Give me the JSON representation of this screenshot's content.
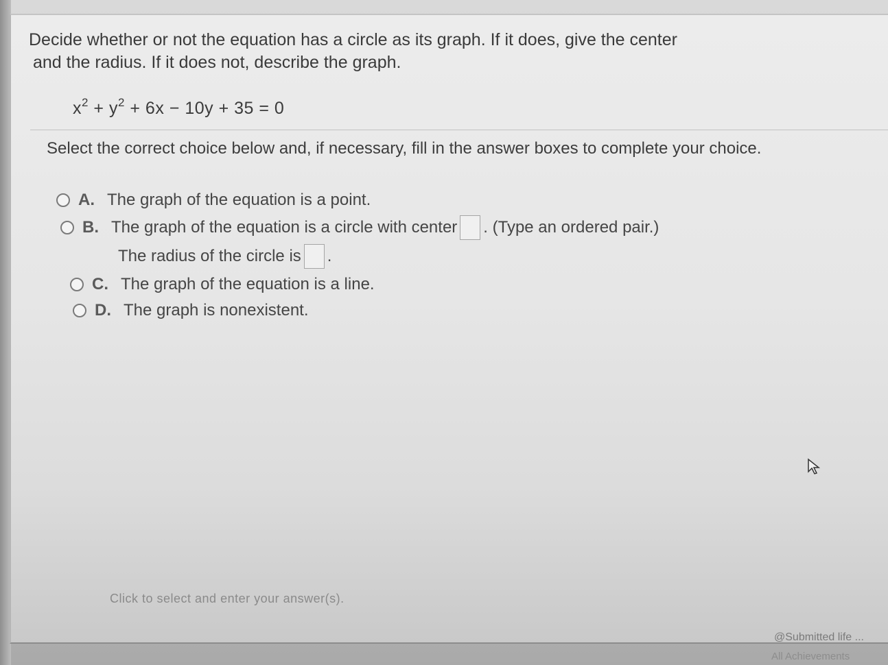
{
  "question": {
    "line1": "Decide whether or not the equation has a circle as its graph. If it does, give the center",
    "line2": "and the radius. If it does not, describe the graph."
  },
  "equation": {
    "t1": "x",
    "e1": "2",
    "t2": " + y",
    "e2": "2",
    "t3": " + 6x − 10y + 35 = 0"
  },
  "instruction": "Select the correct choice below and, if necessary, fill in the answer boxes to complete your choice.",
  "choices": [
    {
      "letter": "A.",
      "text": "The graph of the equation is a point."
    },
    {
      "letter": "B.",
      "text": "The graph of the equation is a circle with center",
      "suffix": ". (Type an ordered pair.)",
      "radius_text": "The radius of the circle is",
      "radius_suffix": "."
    },
    {
      "letter": "C.",
      "text": "The graph of the equation is a line."
    },
    {
      "letter": "D.",
      "text": "The graph is nonexistent."
    }
  ],
  "footer_hint": "Click to select and enter your answer(s).",
  "corner": {
    "line1": "@Submitted life ...",
    "line2": "All Achievements"
  }
}
